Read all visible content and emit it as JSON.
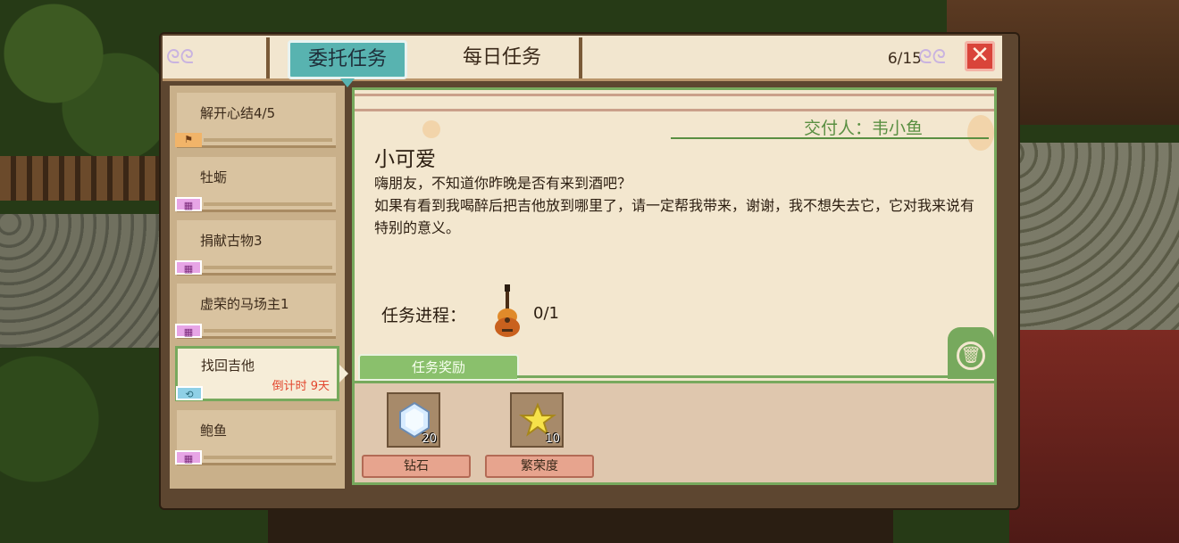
{
  "header": {
    "tabs": [
      "委托任务",
      "每日任务"
    ],
    "active_tab": "委托任务",
    "count": "6/15"
  },
  "quests": [
    {
      "name": "解开心结4/5",
      "tag": "flag"
    },
    {
      "name": "牡蛎",
      "tag": "calendar"
    },
    {
      "name": "捐献古物3",
      "tag": "calendar"
    },
    {
      "name": "虚荣的马场主1",
      "tag": "calendar"
    },
    {
      "name": "找回吉他",
      "tag": "loop",
      "timer": "倒计时 9天",
      "selected": true
    },
    {
      "name": "鲍鱼",
      "tag": "calendar"
    }
  ],
  "detail": {
    "giver": "交付人：韦小鱼",
    "title": "小可爱",
    "description_line1": "嗨朋友，不知道你昨晚是否有来到酒吧？",
    "description_line2": "如果有看到我喝醉后把吉他放到哪里了，请一定帮我带来，谢谢，我不想失去它，它对我来说有特别的意义。",
    "progress_label": "任务进程：",
    "progress_value": "0/1",
    "progress_item_icon": "guitar-icon"
  },
  "rewards": {
    "tab_label": "任务奖励",
    "items": [
      {
        "name": "钻石",
        "qty": "20",
        "icon": "diamond-icon"
      },
      {
        "name": "繁荣度",
        "qty": "10",
        "icon": "star-icon"
      }
    ]
  },
  "colors": {
    "active_tab": "#58b3b0",
    "panel_border": "#77a95d",
    "close_button": "#d9443a",
    "timer_text": "#e2462e"
  }
}
